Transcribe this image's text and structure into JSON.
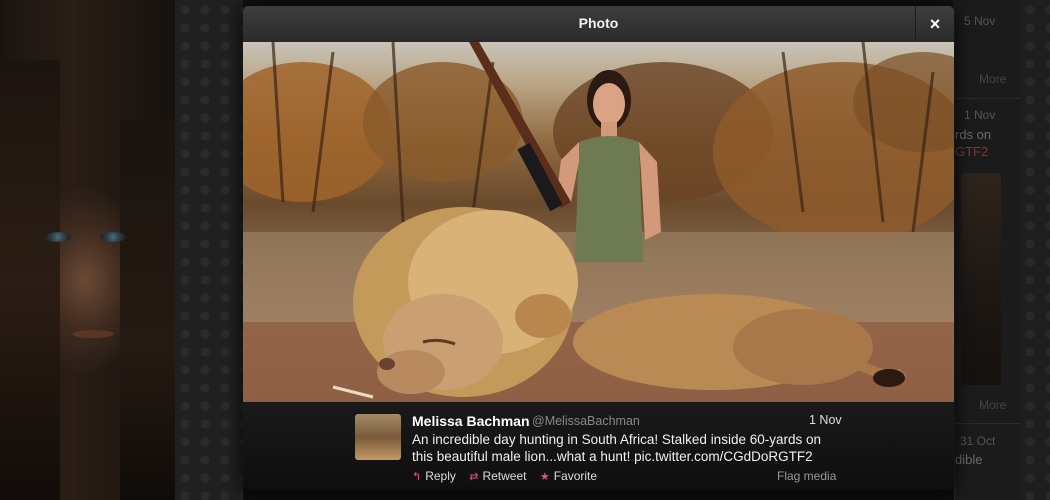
{
  "modal": {
    "title": "Photo",
    "close_glyph": "×"
  },
  "background": {
    "feed_items": [
      {
        "date": "5 Nov",
        "more": "More"
      },
      {
        "date": "1 Nov",
        "snippet_1": "rds on",
        "snippet_2": "GTF2"
      },
      {
        "date": "",
        "more": "More"
      },
      {
        "date": "31 Oct",
        "snippet_1": "dible"
      }
    ]
  },
  "tweet": {
    "author_name": "Melissa Bachman",
    "author_handle": "@MelissaBachman",
    "date": "1 Nov",
    "text_line1": "An incredible day hunting in South Africa! Stalked inside 60-yards on",
    "text_line2": "this beautiful male lion...what a hunt! pic.twitter.com/CGdDoRGTF2",
    "actions": {
      "reply": "Reply",
      "retweet": "Retweet",
      "favorite": "Favorite"
    },
    "flag_media": "Flag media"
  },
  "icons": {
    "reply": "reply-arrow-icon",
    "retweet": "retweet-icon",
    "favorite": "star-icon",
    "close": "close-icon"
  },
  "colors": {
    "action_accent": "#e04f8a",
    "modal_header": "#333333"
  }
}
